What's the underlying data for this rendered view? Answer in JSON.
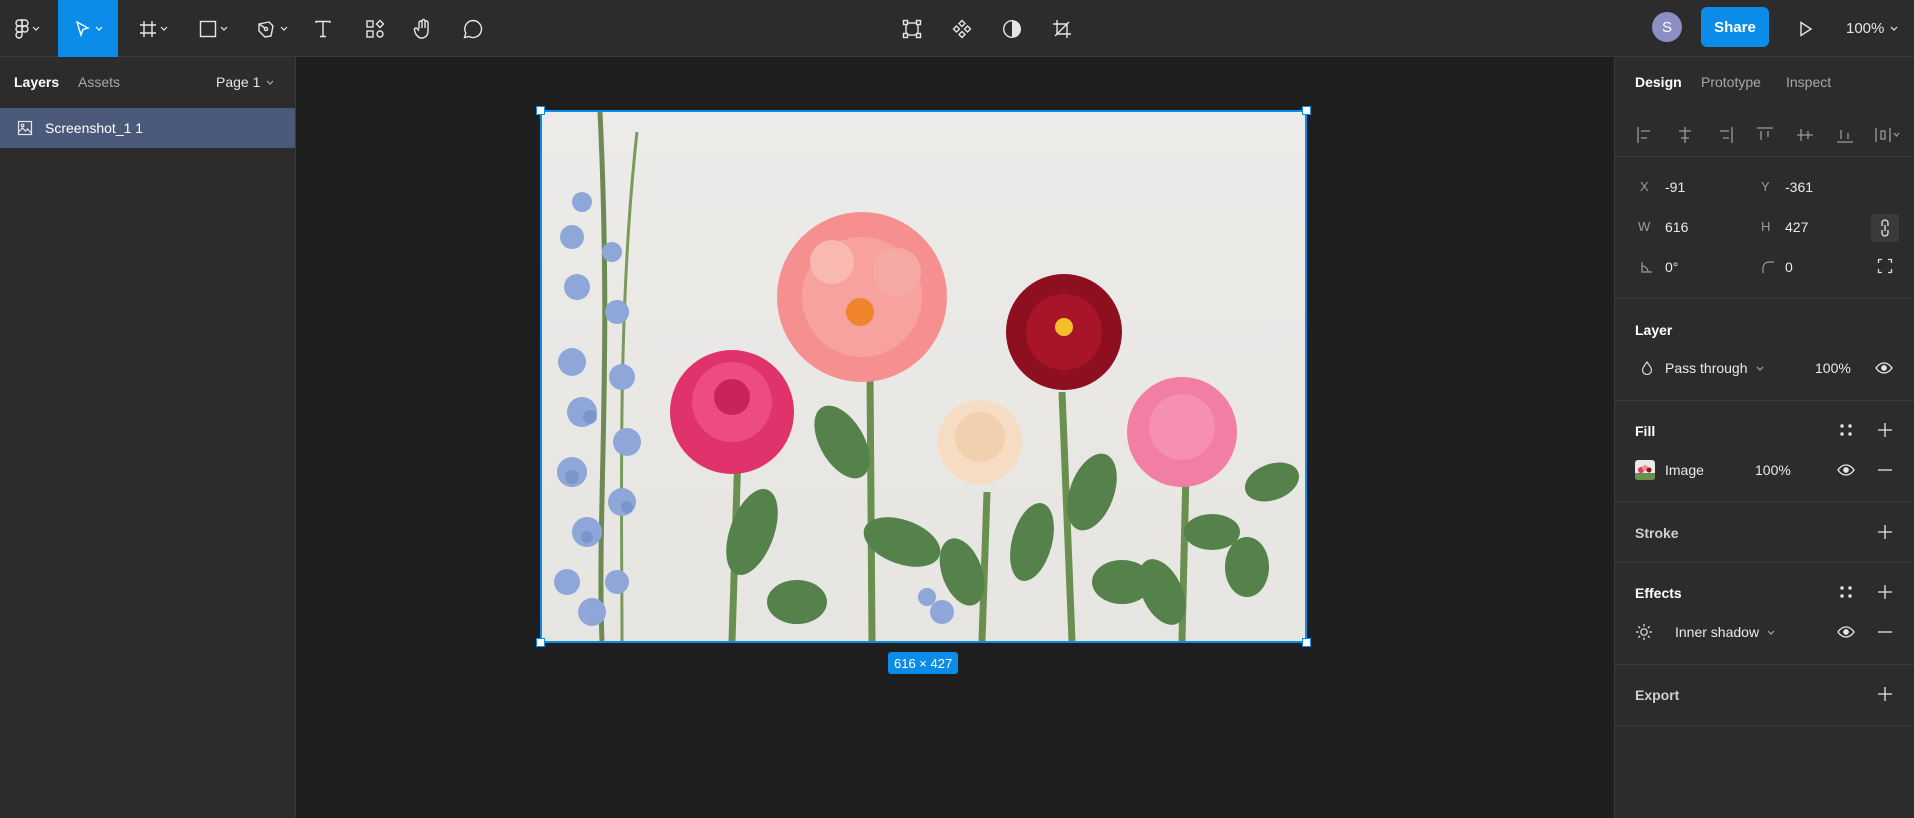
{
  "toolbar": {
    "avatar_initial": "S",
    "share_label": "Share",
    "zoom_label": "100%"
  },
  "left_panel": {
    "tabs": [
      {
        "label": "Layers",
        "active": true
      },
      {
        "label": "Assets",
        "active": false
      }
    ],
    "page_label": "Page 1",
    "layers": [
      {
        "name": "Screenshot_1 1",
        "icon": "image-icon",
        "selected": true
      }
    ]
  },
  "canvas": {
    "selection_size_label": "616 × 427",
    "image_subject": "flowers"
  },
  "right_panel": {
    "tabs": [
      {
        "label": "Design",
        "active": true
      },
      {
        "label": "Prototype",
        "active": false
      },
      {
        "label": "Inspect",
        "active": false
      }
    ],
    "position": {
      "x_label": "X",
      "x_value": "-91",
      "y_label": "Y",
      "y_value": "-361",
      "w_label": "W",
      "w_value": "616",
      "h_label": "H",
      "h_value": "427",
      "rotation_value": "0°",
      "radius_value": "0"
    },
    "layer": {
      "title": "Layer",
      "blend_mode": "Pass through",
      "opacity": "100%"
    },
    "fill": {
      "title": "Fill",
      "type": "Image",
      "opacity": "100%"
    },
    "stroke": {
      "title": "Stroke"
    },
    "effects": {
      "title": "Effects",
      "effect_name": "Inner shadow"
    },
    "export": {
      "title": "Export"
    }
  },
  "colors": {
    "accent": "#0c8ce9",
    "panel_bg": "#2c2c2c",
    "canvas_bg": "#1e1e1e",
    "selected_layer": "#4b5a7a"
  }
}
